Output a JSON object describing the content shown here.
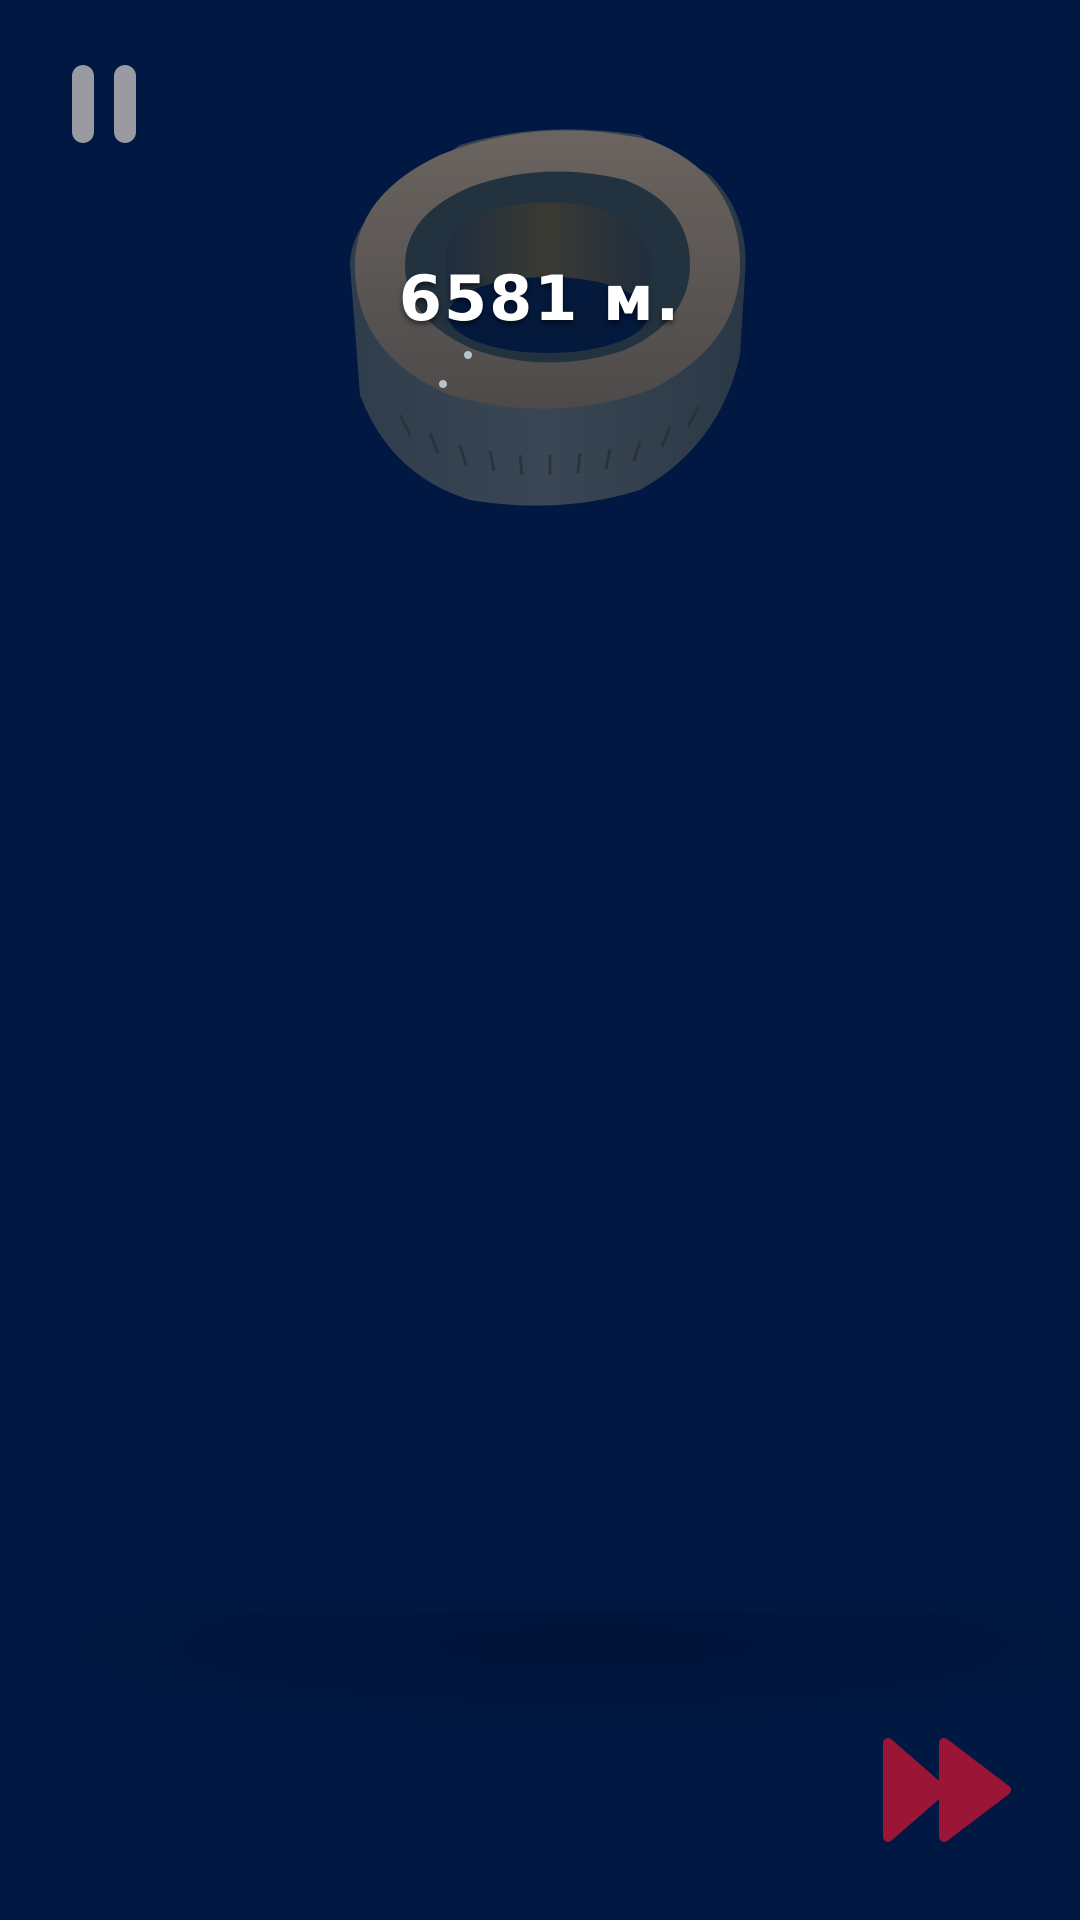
{
  "hud": {
    "distance": "6581 м."
  },
  "icons": {
    "pause": "pause-icon",
    "skip": "fast-forward-icon",
    "tire": "tire-icon"
  },
  "colors": {
    "background": "#001842",
    "pause": "#9a9ba2",
    "skip_button": "#9b1536",
    "distance_text": "#ffffff"
  }
}
